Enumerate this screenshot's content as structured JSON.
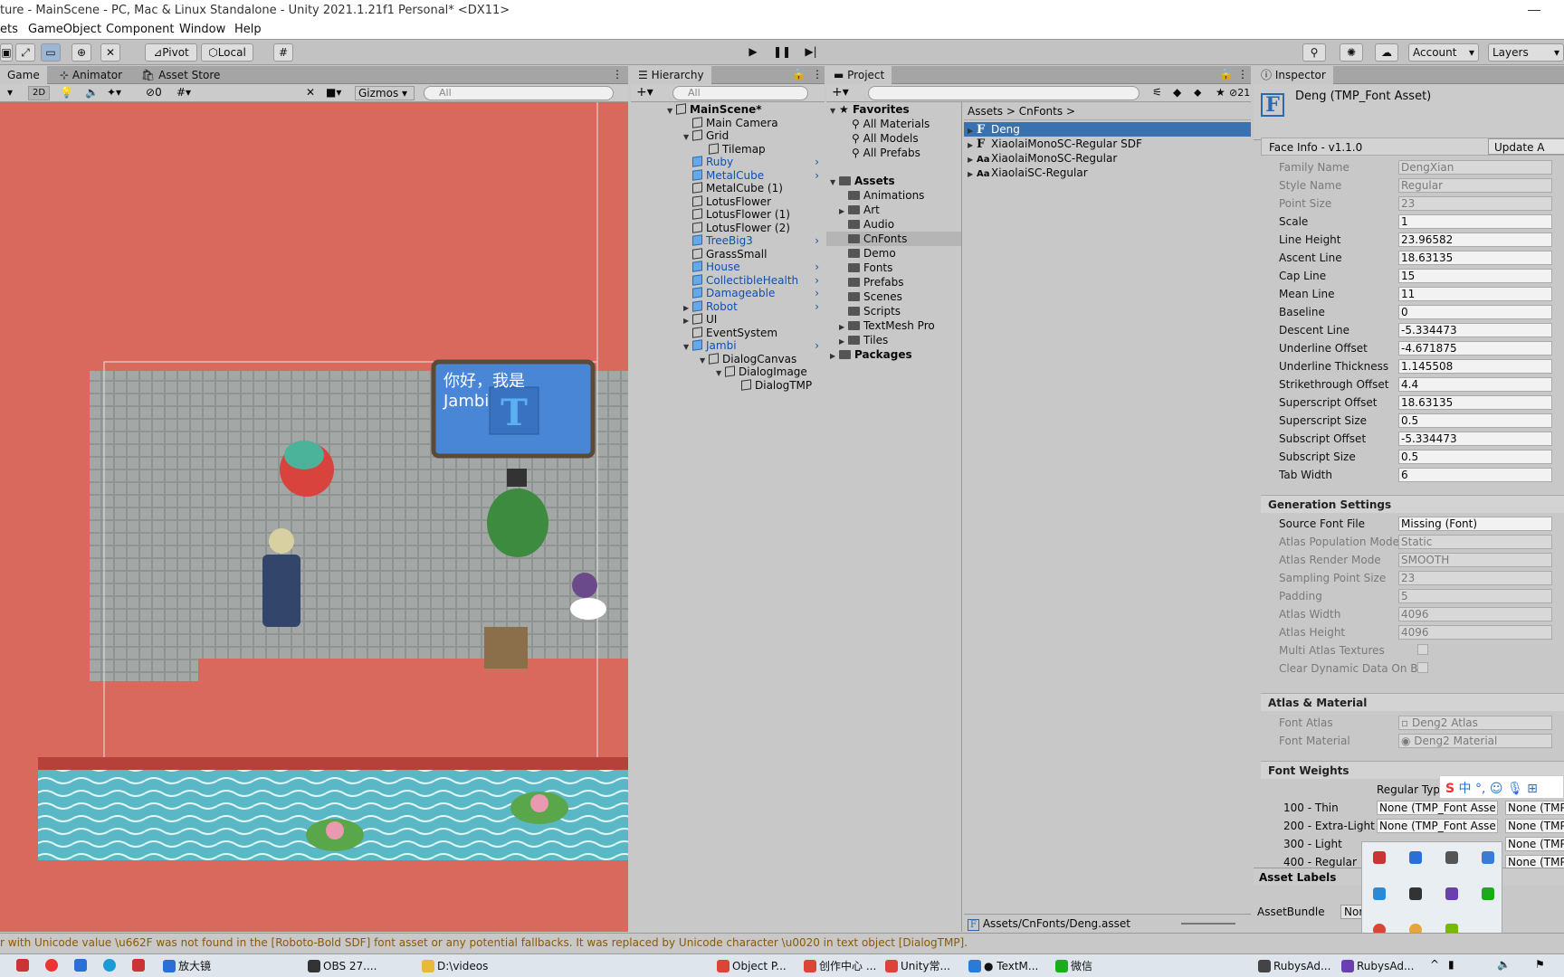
{
  "window": {
    "title": "ture - MainScene - PC, Mac & Linux Standalone - Unity 2021.1.21f1 Personal* <DX11>"
  },
  "menu": [
    "ets",
    "GameObject",
    "Component",
    "Window",
    "Help"
  ],
  "toolbar": {
    "pivot": "Pivot",
    "local": "Local",
    "account": "Account",
    "layers": "Layers"
  },
  "scene": {
    "tabs": [
      "Game",
      "Animator",
      "Asset Store"
    ],
    "mode2d": "2D",
    "hidden_count": "0",
    "gizmos": "Gizmos",
    "search_placeholder": "All",
    "dialog_text_line1": "你好，我是",
    "dialog_text_line2": "Jambi"
  },
  "hierarchy": {
    "tab": "Hierarchy",
    "search_placeholder": "All",
    "items": [
      {
        "label": "MainScene*",
        "indent": 0,
        "expand": "▼",
        "kind": "scene",
        "blue": false,
        "more": false
      },
      {
        "label": "Main Camera",
        "indent": 1,
        "expand": "",
        "kind": "cube",
        "blue": false,
        "more": false
      },
      {
        "label": "Grid",
        "indent": 1,
        "expand": "▼",
        "kind": "cube",
        "blue": false,
        "more": false
      },
      {
        "label": "Tilemap",
        "indent": 2,
        "expand": "",
        "kind": "cube",
        "blue": false,
        "more": false
      },
      {
        "label": "Ruby",
        "indent": 1,
        "expand": "",
        "kind": "cube",
        "blue": true,
        "more": true
      },
      {
        "label": "MetalCube",
        "indent": 1,
        "expand": "",
        "kind": "cube",
        "blue": true,
        "more": true
      },
      {
        "label": "MetalCube (1)",
        "indent": 1,
        "expand": "",
        "kind": "cube",
        "blue": false,
        "more": false
      },
      {
        "label": "LotusFlower",
        "indent": 1,
        "expand": "",
        "kind": "cube",
        "blue": false,
        "more": false
      },
      {
        "label": "LotusFlower (1)",
        "indent": 1,
        "expand": "",
        "kind": "cube",
        "blue": false,
        "more": false
      },
      {
        "label": "LotusFlower (2)",
        "indent": 1,
        "expand": "",
        "kind": "cube",
        "blue": false,
        "more": false
      },
      {
        "label": "TreeBig3",
        "indent": 1,
        "expand": "",
        "kind": "cube",
        "blue": true,
        "more": true
      },
      {
        "label": "GrassSmall",
        "indent": 1,
        "expand": "",
        "kind": "cube",
        "blue": false,
        "more": false
      },
      {
        "label": "House",
        "indent": 1,
        "expand": "",
        "kind": "cube",
        "blue": true,
        "more": true
      },
      {
        "label": "CollectibleHealth",
        "indent": 1,
        "expand": "",
        "kind": "cube",
        "blue": true,
        "more": true
      },
      {
        "label": "Damageable",
        "indent": 1,
        "expand": "",
        "kind": "cube",
        "blue": true,
        "more": true
      },
      {
        "label": "Robot",
        "indent": 1,
        "expand": "▶",
        "kind": "cube",
        "blue": true,
        "more": true
      },
      {
        "label": "UI",
        "indent": 1,
        "expand": "▶",
        "kind": "cube",
        "blue": false,
        "more": false
      },
      {
        "label": "EventSystem",
        "indent": 1,
        "expand": "",
        "kind": "cube",
        "blue": false,
        "more": false
      },
      {
        "label": "Jambi",
        "indent": 1,
        "expand": "▼",
        "kind": "cube",
        "blue": true,
        "more": true
      },
      {
        "label": "DialogCanvas",
        "indent": 2,
        "expand": "▼",
        "kind": "cube",
        "blue": false,
        "more": false
      },
      {
        "label": "DialogImage",
        "indent": 3,
        "expand": "▼",
        "kind": "cube",
        "blue": false,
        "more": false
      },
      {
        "label": "DialogTMP",
        "indent": 4,
        "expand": "",
        "kind": "cube",
        "blue": false,
        "more": false
      }
    ]
  },
  "project": {
    "tab": "Project",
    "favorites_label": "Favorites",
    "favorites": [
      "All Materials",
      "All Models",
      "All Prefabs"
    ],
    "assets_label": "Assets",
    "folders": [
      {
        "label": "Animations",
        "expand": ""
      },
      {
        "label": "Art",
        "expand": "▶"
      },
      {
        "label": "Audio",
        "expand": ""
      },
      {
        "label": "CnFonts",
        "expand": ""
      },
      {
        "label": "Demo",
        "expand": ""
      },
      {
        "label": "Fonts",
        "expand": ""
      },
      {
        "label": "Prefabs",
        "expand": ""
      },
      {
        "label": "Scenes",
        "expand": ""
      },
      {
        "label": "Scripts",
        "expand": ""
      },
      {
        "label": "TextMesh Pro",
        "expand": "▶"
      },
      {
        "label": "Tiles",
        "expand": "▶"
      }
    ],
    "packages_label": "Packages",
    "breadcrumb": [
      "Assets",
      "CnFonts"
    ],
    "hidden_count": "21",
    "files": [
      {
        "icon": "F",
        "label": "Deng"
      },
      {
        "icon": "F",
        "label": "XiaolaiMonoSC-Regular SDF"
      },
      {
        "icon": "Aa",
        "label": "XiaolaiMonoSC-Regular"
      },
      {
        "icon": "Aa",
        "label": "XiaolaiSC-Regular"
      }
    ],
    "footer_path": "Assets/CnFonts/Deng.asset"
  },
  "inspector": {
    "tab": "Inspector",
    "asset_title": "Deng (TMP_Font Asset)",
    "face_info_label": "Face Info - v1.1.0",
    "update_button": "Update A",
    "face_fields": [
      {
        "label": "Family Name",
        "value": "DengXian",
        "dim": true
      },
      {
        "label": "Style Name",
        "value": "Regular",
        "dim": true
      },
      {
        "label": "Point Size",
        "value": "23",
        "dim": true
      },
      {
        "label": "Scale",
        "value": "1",
        "dim": false
      },
      {
        "label": "Line Height",
        "value": "23.96582",
        "dim": false
      },
      {
        "label": "Ascent Line",
        "value": "18.63135",
        "dim": false
      },
      {
        "label": "Cap Line",
        "value": "15",
        "dim": false
      },
      {
        "label": "Mean Line",
        "value": "11",
        "dim": false
      },
      {
        "label": "Baseline",
        "value": "0",
        "dim": false
      },
      {
        "label": "Descent Line",
        "value": "-5.334473",
        "dim": false
      },
      {
        "label": "Underline Offset",
        "value": "-4.671875",
        "dim": false
      },
      {
        "label": "Underline Thickness",
        "value": "1.145508",
        "dim": false
      },
      {
        "label": "Strikethrough Offset",
        "value": "4.4",
        "dim": false
      },
      {
        "label": "Superscript Offset",
        "value": "18.63135",
        "dim": false
      },
      {
        "label": "Superscript Size",
        "value": "0.5",
        "dim": false
      },
      {
        "label": "Subscript Offset",
        "value": "-5.334473",
        "dim": false
      },
      {
        "label": "Subscript Size",
        "value": "0.5",
        "dim": false
      },
      {
        "label": "Tab Width",
        "value": "6",
        "dim": false
      }
    ],
    "generation_label": "Generation Settings",
    "generation_fields": [
      {
        "label": "Source Font File",
        "value": "Missing (Font)",
        "dim": false
      },
      {
        "label": "Atlas Population Mode",
        "value": "Static",
        "dim": true
      },
      {
        "label": "Atlas Render Mode",
        "value": "SMOOTH",
        "dim": true
      },
      {
        "label": "Sampling Point Size",
        "value": "23",
        "dim": true
      },
      {
        "label": "Padding",
        "value": "5",
        "dim": true
      },
      {
        "label": "Atlas Width",
        "value": "4096",
        "dim": true
      },
      {
        "label": "Atlas Height",
        "value": "4096",
        "dim": true
      }
    ],
    "multi_atlas_label": "Multi Atlas Textures",
    "clear_dynamic_label": "Clear Dynamic Data On B",
    "atlas_material_label": "Atlas & Material",
    "font_atlas_label": "Font Atlas",
    "font_atlas_value": "Deng2 Atlas",
    "font_material_label": "Font Material",
    "font_material_value": "Deng2 Material",
    "font_weights_label": "Font Weights",
    "regular_typeface": "Regular Typ",
    "weights": [
      {
        "label": "100 - Thin",
        "a": "None (TMP_Font Asse",
        "b": "None (TMP"
      },
      {
        "label": "200 - Extra-Light",
        "a": "None (TMP_Font Asse",
        "b": "None (TMP"
      },
      {
        "label": "300 - Light",
        "a": "",
        "b": "None (TMP"
      },
      {
        "label": "400 - Regular",
        "a": "",
        "b": "None (TMP"
      }
    ],
    "asset_labels": "Asset Labels",
    "asset_bundle_label": "AssetBundle",
    "asset_bundle_value": "Nor"
  },
  "console": {
    "message": "r with Unicode value \\u662F was not found in the [Roboto-Bold SDF] font asset or any potential fallbacks. It was replaced by Unicode character \\u0020 in text object [DialogTMP]."
  },
  "taskbar": {
    "items": [
      {
        "label": "放大镜",
        "color": "#2a6fd6"
      },
      {
        "label": "OBS 27....",
        "color": "#333333"
      },
      {
        "label": "D:\\videos",
        "color": "#e8b93a"
      },
      {
        "label": "Object P...",
        "color": "#db4437"
      },
      {
        "label": "创作中心 ...",
        "color": "#db4437"
      },
      {
        "label": "Unity常...",
        "color": "#db4437"
      },
      {
        "label": "● TextM...",
        "color": "#2a7bd6"
      },
      {
        "label": "微信",
        "color": "#1aad19"
      },
      {
        "label": "RubysAd...",
        "color": "#444444"
      },
      {
        "label": "RubysAd...",
        "color": "#6b3fb0"
      }
    ]
  },
  "colors": {
    "scene_bg": "#d9685d",
    "water": "#5ab8c6",
    "dialog_blue": "#4a86d6",
    "selection": "#3a72b0",
    "prefab_blue": "#0e4fb6"
  }
}
